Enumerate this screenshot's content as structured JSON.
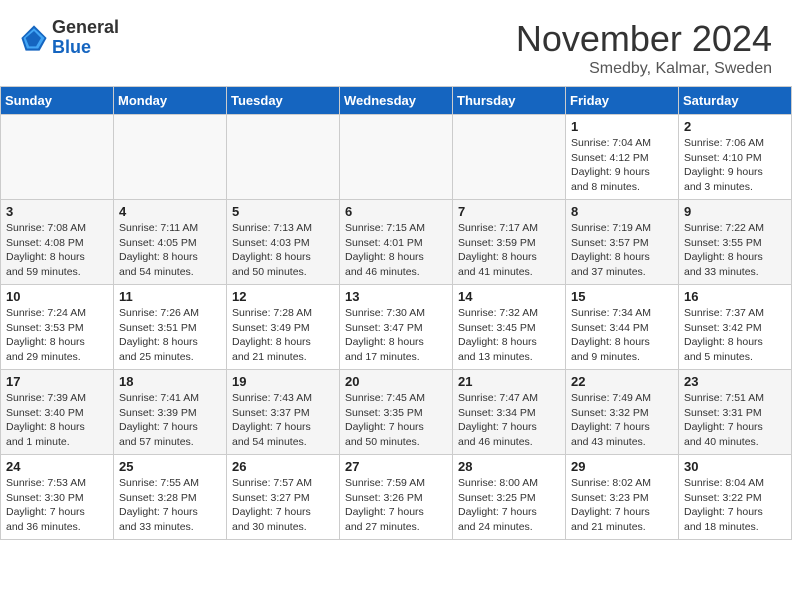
{
  "header": {
    "logo_general": "General",
    "logo_blue": "Blue",
    "month": "November 2024",
    "location": "Smedby, Kalmar, Sweden"
  },
  "weekdays": [
    "Sunday",
    "Monday",
    "Tuesday",
    "Wednesday",
    "Thursday",
    "Friday",
    "Saturday"
  ],
  "weeks": [
    [
      {
        "day": "",
        "info": ""
      },
      {
        "day": "",
        "info": ""
      },
      {
        "day": "",
        "info": ""
      },
      {
        "day": "",
        "info": ""
      },
      {
        "day": "",
        "info": ""
      },
      {
        "day": "1",
        "info": "Sunrise: 7:04 AM\nSunset: 4:12 PM\nDaylight: 9 hours\nand 8 minutes."
      },
      {
        "day": "2",
        "info": "Sunrise: 7:06 AM\nSunset: 4:10 PM\nDaylight: 9 hours\nand 3 minutes."
      }
    ],
    [
      {
        "day": "3",
        "info": "Sunrise: 7:08 AM\nSunset: 4:08 PM\nDaylight: 8 hours\nand 59 minutes."
      },
      {
        "day": "4",
        "info": "Sunrise: 7:11 AM\nSunset: 4:05 PM\nDaylight: 8 hours\nand 54 minutes."
      },
      {
        "day": "5",
        "info": "Sunrise: 7:13 AM\nSunset: 4:03 PM\nDaylight: 8 hours\nand 50 minutes."
      },
      {
        "day": "6",
        "info": "Sunrise: 7:15 AM\nSunset: 4:01 PM\nDaylight: 8 hours\nand 46 minutes."
      },
      {
        "day": "7",
        "info": "Sunrise: 7:17 AM\nSunset: 3:59 PM\nDaylight: 8 hours\nand 41 minutes."
      },
      {
        "day": "8",
        "info": "Sunrise: 7:19 AM\nSunset: 3:57 PM\nDaylight: 8 hours\nand 37 minutes."
      },
      {
        "day": "9",
        "info": "Sunrise: 7:22 AM\nSunset: 3:55 PM\nDaylight: 8 hours\nand 33 minutes."
      }
    ],
    [
      {
        "day": "10",
        "info": "Sunrise: 7:24 AM\nSunset: 3:53 PM\nDaylight: 8 hours\nand 29 minutes."
      },
      {
        "day": "11",
        "info": "Sunrise: 7:26 AM\nSunset: 3:51 PM\nDaylight: 8 hours\nand 25 minutes."
      },
      {
        "day": "12",
        "info": "Sunrise: 7:28 AM\nSunset: 3:49 PM\nDaylight: 8 hours\nand 21 minutes."
      },
      {
        "day": "13",
        "info": "Sunrise: 7:30 AM\nSunset: 3:47 PM\nDaylight: 8 hours\nand 17 minutes."
      },
      {
        "day": "14",
        "info": "Sunrise: 7:32 AM\nSunset: 3:45 PM\nDaylight: 8 hours\nand 13 minutes."
      },
      {
        "day": "15",
        "info": "Sunrise: 7:34 AM\nSunset: 3:44 PM\nDaylight: 8 hours\nand 9 minutes."
      },
      {
        "day": "16",
        "info": "Sunrise: 7:37 AM\nSunset: 3:42 PM\nDaylight: 8 hours\nand 5 minutes."
      }
    ],
    [
      {
        "day": "17",
        "info": "Sunrise: 7:39 AM\nSunset: 3:40 PM\nDaylight: 8 hours\nand 1 minute."
      },
      {
        "day": "18",
        "info": "Sunrise: 7:41 AM\nSunset: 3:39 PM\nDaylight: 7 hours\nand 57 minutes."
      },
      {
        "day": "19",
        "info": "Sunrise: 7:43 AM\nSunset: 3:37 PM\nDaylight: 7 hours\nand 54 minutes."
      },
      {
        "day": "20",
        "info": "Sunrise: 7:45 AM\nSunset: 3:35 PM\nDaylight: 7 hours\nand 50 minutes."
      },
      {
        "day": "21",
        "info": "Sunrise: 7:47 AM\nSunset: 3:34 PM\nDaylight: 7 hours\nand 46 minutes."
      },
      {
        "day": "22",
        "info": "Sunrise: 7:49 AM\nSunset: 3:32 PM\nDaylight: 7 hours\nand 43 minutes."
      },
      {
        "day": "23",
        "info": "Sunrise: 7:51 AM\nSunset: 3:31 PM\nDaylight: 7 hours\nand 40 minutes."
      }
    ],
    [
      {
        "day": "24",
        "info": "Sunrise: 7:53 AM\nSunset: 3:30 PM\nDaylight: 7 hours\nand 36 minutes."
      },
      {
        "day": "25",
        "info": "Sunrise: 7:55 AM\nSunset: 3:28 PM\nDaylight: 7 hours\nand 33 minutes."
      },
      {
        "day": "26",
        "info": "Sunrise: 7:57 AM\nSunset: 3:27 PM\nDaylight: 7 hours\nand 30 minutes."
      },
      {
        "day": "27",
        "info": "Sunrise: 7:59 AM\nSunset: 3:26 PM\nDaylight: 7 hours\nand 27 minutes."
      },
      {
        "day": "28",
        "info": "Sunrise: 8:00 AM\nSunset: 3:25 PM\nDaylight: 7 hours\nand 24 minutes."
      },
      {
        "day": "29",
        "info": "Sunrise: 8:02 AM\nSunset: 3:23 PM\nDaylight: 7 hours\nand 21 minutes."
      },
      {
        "day": "30",
        "info": "Sunrise: 8:04 AM\nSunset: 3:22 PM\nDaylight: 7 hours\nand 18 minutes."
      }
    ]
  ]
}
